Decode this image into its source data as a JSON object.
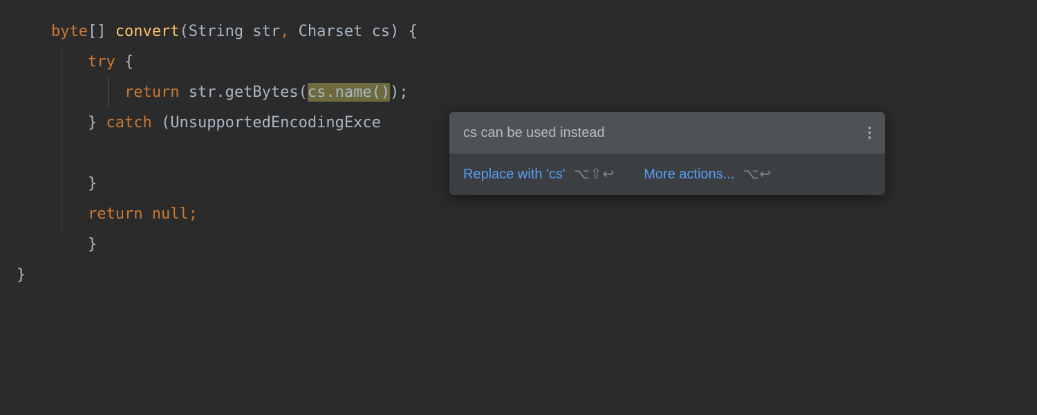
{
  "code": {
    "l1_type": "byte",
    "l1_brackets": "[] ",
    "l1_method": "convert",
    "l1_params_open": "(String str",
    "l1_comma": ", ",
    "l1_params_close": "Charset cs) {",
    "l2_try": "try",
    "l2_brace": " {",
    "l3_return": "return",
    "l3_call1": " str.getBytes(",
    "l3_highlight": "cs.name()",
    "l3_call2": ");",
    "l4_brace": "} ",
    "l4_catch": "catch",
    "l4_paren": " (UnsupportedEncodingExce",
    "l5_empty": "",
    "l6_brace": "}",
    "l7_return": "return null",
    "l7_semi": ";",
    "l8_brace": "}",
    "l9_brace": "}"
  },
  "popup": {
    "title": "cs can be used instead",
    "action1": "Replace with 'cs'",
    "shortcut1": "⌥⇧↩",
    "action2": "More actions...",
    "shortcut2": "⌥↩"
  }
}
